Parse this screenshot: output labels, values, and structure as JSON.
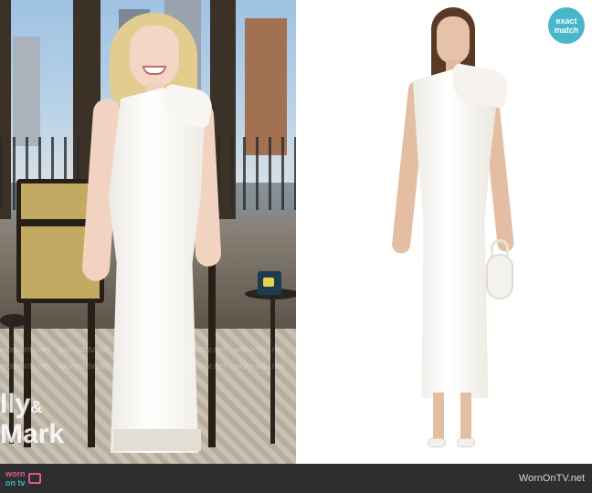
{
  "left_photo": {
    "show_title_line1": "lly",
    "show_title_amp": "&",
    "show_title_line2": "Mark",
    "watermark_text": "womontv.net"
  },
  "logo": {
    "line1": "worn",
    "line2": "on tv"
  },
  "right_photo": {
    "badge_line1": "exact",
    "badge_line2": "match"
  },
  "footer": {
    "site_credit": "WornOnTV.net"
  },
  "colors": {
    "badge_bg": "#47b7c9",
    "logo_pink": "#e0559c",
    "logo_teal": "#3fb7c7",
    "footer_bg": "#2e2e2e"
  }
}
